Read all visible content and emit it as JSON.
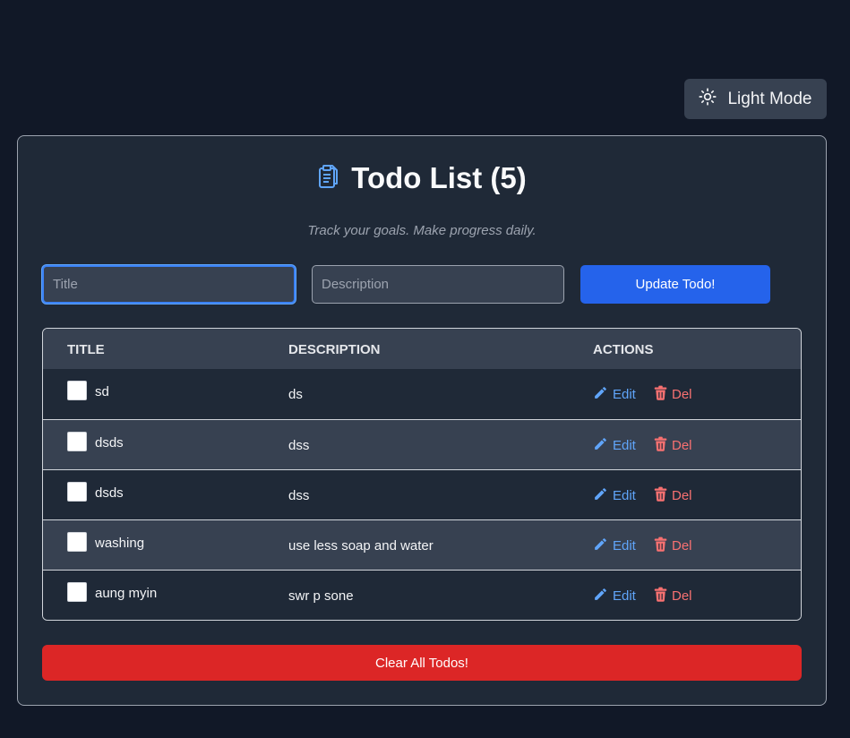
{
  "theme_toggle": {
    "label": "Light Mode",
    "icon": "sun-icon"
  },
  "header": {
    "title": "Todo List (5)",
    "subtitle": "Track your goals. Make progress daily.",
    "icon": "clipboard-icon",
    "icon_color": "#60a5fa"
  },
  "form": {
    "title_placeholder": "Title",
    "title_value": "",
    "description_placeholder": "Description",
    "description_value": "",
    "submit_label": "Update Todo!"
  },
  "table": {
    "headers": {
      "title": "TITLE",
      "description": "DESCRIPTION",
      "actions": "ACTIONS"
    },
    "edit_label": "Edit",
    "delete_label": "Del",
    "rows": [
      {
        "title": "sd",
        "description": "ds",
        "completed": false
      },
      {
        "title": "dsds",
        "description": "dss",
        "completed": false
      },
      {
        "title": "dsds",
        "description": "dss",
        "completed": false
      },
      {
        "title": "washing",
        "description": "use less soap and water",
        "completed": false
      },
      {
        "title": "aung myin",
        "description": "swr p sone",
        "completed": false
      }
    ]
  },
  "clear_button": {
    "label": "Clear All Todos!"
  },
  "colors": {
    "background": "#111827",
    "card": "#1f2937",
    "accent": "#2563eb",
    "danger": "#dc2626",
    "edit": "#60a5fa",
    "delete": "#f87171"
  }
}
